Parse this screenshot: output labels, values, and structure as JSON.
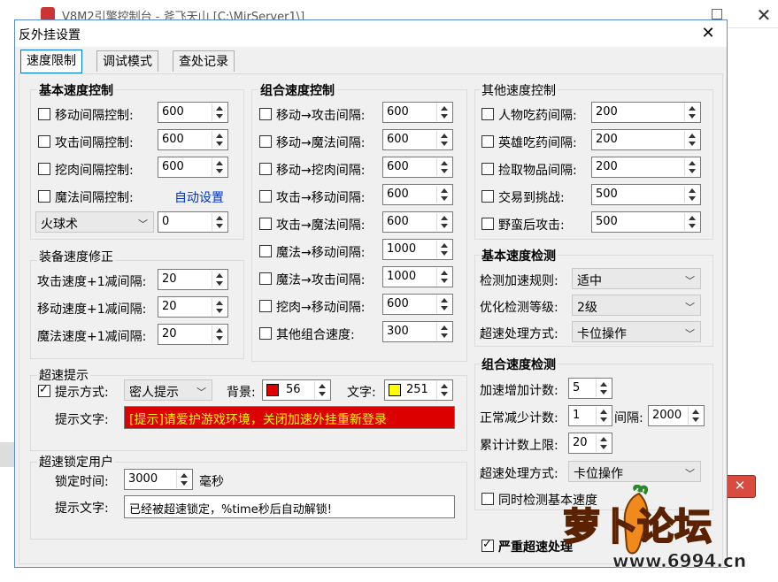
{
  "background": {
    "title": "V8M2引擎控制台 - 斧飞天山 [C:\\MirServer1\\]",
    "accent_color": "#d94b3f"
  },
  "dialog": {
    "title": "反外挂设置",
    "close_glyph": "✕",
    "border_color": "#5a8cc8"
  },
  "tabs": [
    {
      "label": "速度限制"
    },
    {
      "label": "调试模式"
    },
    {
      "label": "查处记录"
    }
  ],
  "basic_speed": {
    "title": "基本速度控制",
    "rows": [
      {
        "label": "移动间隔控制:",
        "checked": false,
        "value": "600"
      },
      {
        "label": "攻击间隔控制:",
        "checked": false,
        "value": "600"
      },
      {
        "label": "挖肉间隔控制:",
        "checked": false,
        "value": "600"
      },
      {
        "label": "魔法间隔控制:",
        "checked": false
      }
    ],
    "auto_link": "自动设置",
    "spell_combo": "火球术",
    "spell_value": "0"
  },
  "equip_speed": {
    "title": "装备速度修正",
    "rows": [
      {
        "label": "攻击速度+1减间隔:",
        "value": "20"
      },
      {
        "label": "移动速度+1减间隔:",
        "value": "20"
      },
      {
        "label": "魔法速度+1减间隔:",
        "value": "20"
      }
    ]
  },
  "combo_speed": {
    "title": "组合速度控制",
    "rows": [
      {
        "label": "移动→攻击间隔:",
        "checked": false,
        "value": "600"
      },
      {
        "label": "移动→魔法间隔:",
        "checked": false,
        "value": "600"
      },
      {
        "label": "移动→挖肉间隔:",
        "checked": false,
        "value": "600"
      },
      {
        "label": "攻击→移动间隔:",
        "checked": false,
        "value": "600"
      },
      {
        "label": "攻击→魔法间隔:",
        "checked": false,
        "value": "600"
      },
      {
        "label": "魔法→移动间隔:",
        "checked": false,
        "value": "1000"
      },
      {
        "label": "魔法→攻击间隔:",
        "checked": false,
        "value": "1000"
      },
      {
        "label": "挖肉→移动间隔:",
        "checked": false,
        "value": "600"
      },
      {
        "label": "其他组合速度:",
        "checked": false,
        "value": "300"
      }
    ]
  },
  "other_speed": {
    "title": "其他速度控制",
    "rows": [
      {
        "label": "人物吃药间隔:",
        "checked": false,
        "value": "200"
      },
      {
        "label": "英雄吃药间隔:",
        "checked": false,
        "value": "200"
      },
      {
        "label": "捡取物品间隔:",
        "checked": false,
        "value": "200"
      },
      {
        "label": "交易到挑战:",
        "checked": false,
        "value": "500"
      },
      {
        "label": "野蛮后攻击:",
        "checked": false,
        "value": "500"
      }
    ]
  },
  "basic_detect": {
    "title": "基本速度检测",
    "rows": [
      {
        "label": "检测加速规则:",
        "value": "适中"
      },
      {
        "label": "优化检测等级:",
        "value": "2级"
      },
      {
        "label": "超速处理方式:",
        "value": "卡位操作"
      }
    ]
  },
  "speed_prompt": {
    "title": "超速提示",
    "mode_label": "提示方式:",
    "mode_checked": true,
    "mode_value": "密人提示",
    "bg_label": "背景:",
    "bg_value": "56",
    "bg_color": "#dd0000",
    "fg_label": "文字:",
    "fg_value": "251",
    "fg_color": "#ffff00",
    "text_label": "提示文字:",
    "text_value": "[提示]请爱护游戏环境，关闭加速外挂重新登录"
  },
  "combo_detect": {
    "title": "组合速度检测",
    "inc_label": "加速增加计数:",
    "inc_value": "5",
    "dec_label": "正常减少计数:",
    "dec_value": "1",
    "interval_label": "间隔:",
    "interval_value": "2000",
    "limit_label": "累计计数上限:",
    "limit_value": "20",
    "handle_label": "超速处理方式:",
    "handle_value": "卡位操作",
    "sync_label": "同时检测基本速度",
    "sync_checked": false
  },
  "lock_user": {
    "title": "超速锁定用户",
    "time_label": "锁定时间:",
    "time_value": "3000",
    "unit": "毫秒",
    "text_label": "提示文字:",
    "text_value": "已经被超速锁定，%time秒后自动解锁!"
  },
  "severe": {
    "label": "严重超速处理",
    "checked": true
  },
  "watermark": {
    "brand": "萝卜论坛",
    "url": "www.6994.cn"
  }
}
